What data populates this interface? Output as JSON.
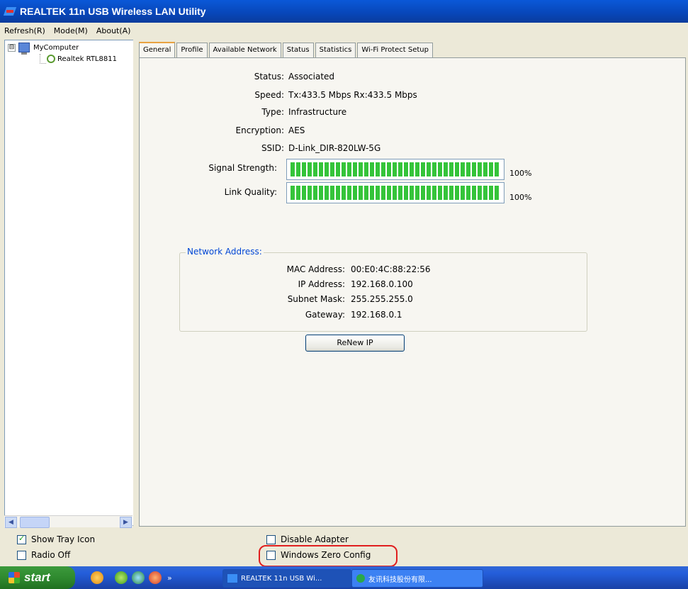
{
  "window": {
    "title": "REALTEK 11n USB Wireless LAN Utility"
  },
  "menu": [
    "Refresh(R)",
    "Mode(M)",
    "About(A)"
  ],
  "tree": {
    "expander": "⊟",
    "root": "MyComputer",
    "child": "Realtek RTL8811"
  },
  "tabs": [
    "General",
    "Profile",
    "Available Network",
    "Status",
    "Statistics",
    "Wi-Fi Protect Setup"
  ],
  "general": {
    "status_label": "Status:",
    "status_value": "Associated",
    "speed_label": "Speed:",
    "speed_value": "Tx:433.5 Mbps Rx:433.5 Mbps",
    "type_label": "Type:",
    "type_value": "Infrastructure",
    "encryption_label": "Encryption:",
    "encryption_value": "AES",
    "ssid_label": "SSID:",
    "ssid_value": "D-Link_DIR-820LW-5G",
    "signal_label": "Signal Strength:",
    "signal_percent": "100%",
    "signal_level": 100,
    "link_label": "Link Quality:",
    "link_percent": "100%",
    "link_level": 100
  },
  "network": {
    "legend": "Network Address:",
    "mac_label": "MAC Address:",
    "mac_value": "00:E0:4C:88:22:56",
    "ip_label": "IP Address:",
    "ip_value": "192.168.0.100",
    "mask_label": "Subnet Mask:",
    "mask_value": "255.255.255.0",
    "gateway_label": "Gateway:",
    "gateway_value": "192.168.0.1",
    "renew_label": "ReNew IP"
  },
  "options": {
    "show_tray": {
      "label": "Show Tray Icon",
      "checked": true
    },
    "radio_off": {
      "label": "Radio Off",
      "checked": false
    },
    "disable_adapter": {
      "label": "Disable Adapter",
      "checked": false
    },
    "wzc": {
      "label": "Windows Zero Config",
      "checked": false
    }
  },
  "taskbar": {
    "start": "start",
    "overflow": "»",
    "button1": "REALTEK 11n USB Wi...",
    "button2": "友讯科技股份有限..."
  },
  "colors": {
    "accent_highlight": "#e01f1f",
    "signal_bar": "#35c43a",
    "group_legend": "#0046d5"
  }
}
